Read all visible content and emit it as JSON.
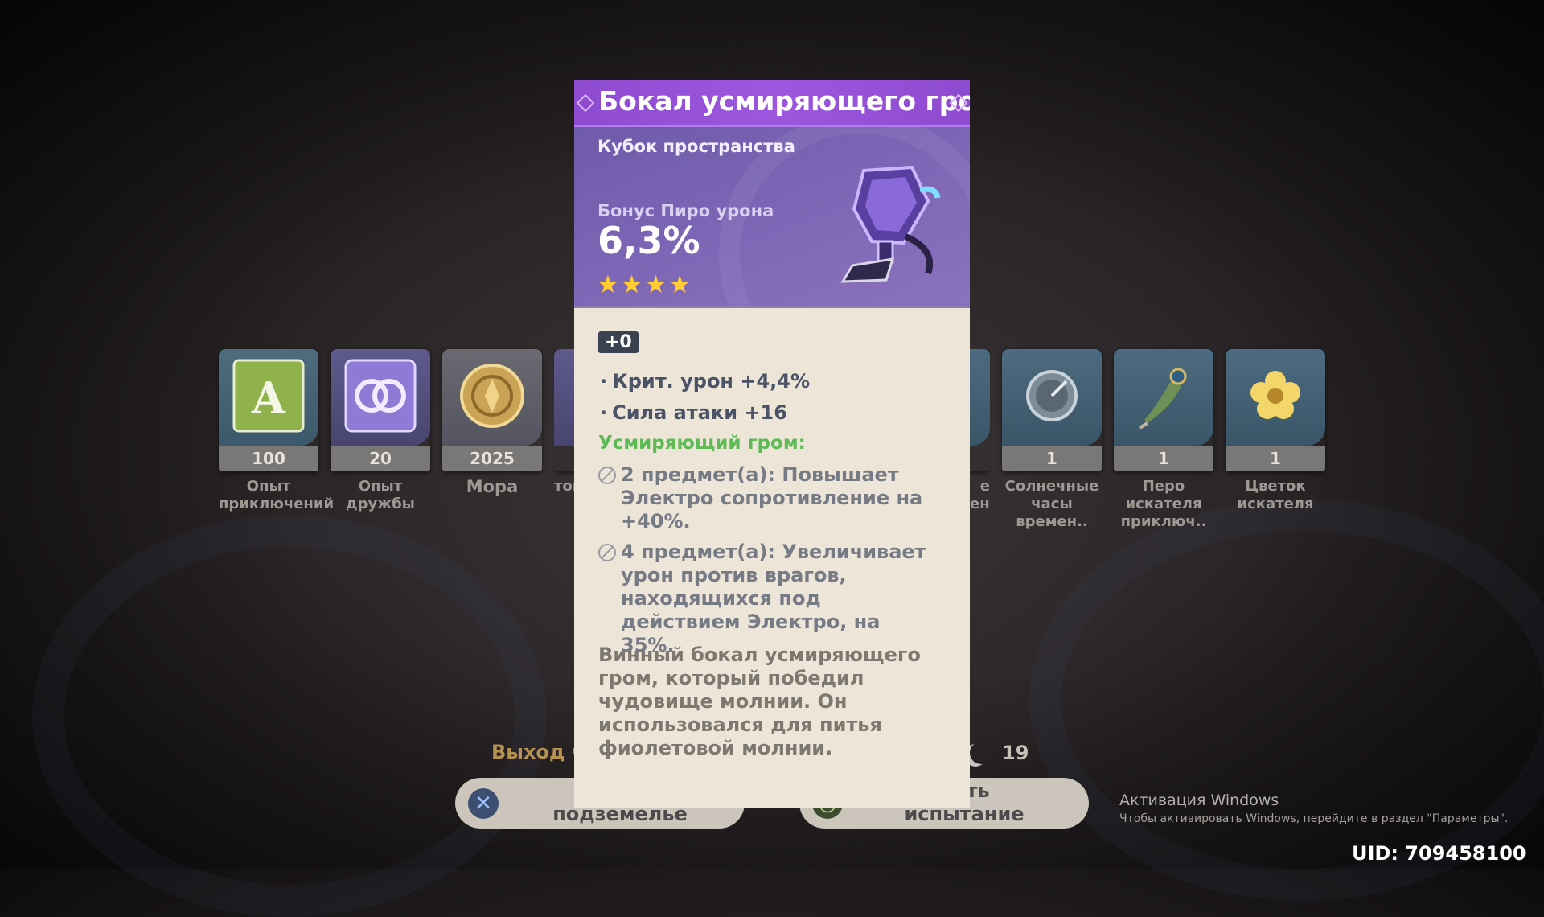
{
  "rewards": {
    "items": [
      {
        "name": "Опыт приключений",
        "count": "100",
        "icon": "adventure-exp-icon"
      },
      {
        "name": "Опыт дружбы",
        "count": "20",
        "icon": "companionship-exp-icon"
      },
      {
        "name": "Мора",
        "count": "2025",
        "icon": "mora-icon"
      },
      {
        "name": "тов",
        "count": "",
        "icon": "artifact-icon"
      },
      {
        "name": "е ен..",
        "count": "",
        "icon": "artifact-icon"
      },
      {
        "name": "Солнечные часы времен..",
        "count": "1",
        "icon": "sands-icon"
      },
      {
        "name": "Перо искателя приключ..",
        "count": "1",
        "icon": "plume-icon"
      },
      {
        "name": "Цветок искателя",
        "count": "1",
        "icon": "flower-icon"
      }
    ]
  },
  "tooltip": {
    "title": "Бокал усмиряющего гром",
    "type": "Кубок пространства",
    "main_stat_name": "Бонус Пиро урона",
    "main_stat_value": "6,3%",
    "rarity_stars": 4,
    "stars_text": "★★★★",
    "level": "+0",
    "substats": [
      "Крит. урон +4,4%",
      "Сила атаки +16"
    ],
    "set_name": "Усмиряющий гром:",
    "set_effects": [
      "2 предмет(а): Повышает Электро сопротивление на +40%.",
      "4 предмет(а): Увеличивает урон против врагов, находящихся под действием Электро, на 35%."
    ],
    "description": "Винный бокал усмиряющего гром, который победил чудовище молнии. Он использовался для питья фиолетовой молнии.",
    "colors": {
      "title_bar": "#9b57de",
      "header": "#7a63b3",
      "set_name": "#5dba54",
      "star": "#ffcc32"
    }
  },
  "footer": {
    "exit_label": "Выход ч",
    "moon_count": "19",
    "left_button": "П\nподземелье",
    "right_button": "рить\nиспытание"
  },
  "windows_notice": {
    "title": "Активация Windows",
    "subtitle": "Чтобы активировать Windows, перейдите в раздел \"Параметры\"."
  },
  "uid": "UID: 709458100"
}
